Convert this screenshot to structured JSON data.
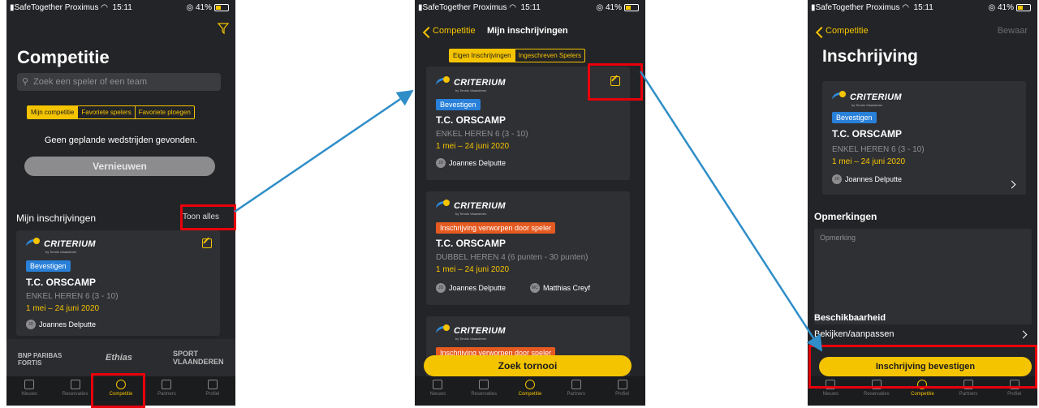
{
  "status": {
    "carrier": "SafeTogether Proximus",
    "time": "15:11",
    "battery": "41%"
  },
  "common": {
    "logo_text": "CRITERIUM",
    "logo_sub": "by Tennis Vlaanderen",
    "avatar_initials": "JD",
    "club": "T.C. ORSCAMP",
    "dates": "1 mei – 24 juni 2020",
    "player1": "Joannes Delputte",
    "badge_confirm": "Bevestigen",
    "badge_rejected": "Inschrijving verworpen door speler",
    "cat_single": "ENKEL HEREN 6 (3 - 10)"
  },
  "tabs": [
    "Nieuws",
    "Reservaties",
    "Competitie",
    "Partners",
    "Profiel"
  ],
  "screen1": {
    "title": "Competitie",
    "search_placeholder": "Zoek een speler of een team",
    "segments": [
      "Mijn competitie",
      "Favoriete spelers",
      "Favoriete ploegen"
    ],
    "empty_text": "Geen geplande wedstrijden gevonden.",
    "refresh_label": "Vernieuwen",
    "section_title": "Mijn inschrijvingen",
    "show_all": "Toon alles",
    "sponsors": [
      "BNP PARIBAS FORTIS",
      "Ethias",
      "SPORT VLAANDEREN"
    ]
  },
  "screen2": {
    "back_label": "Competitie",
    "title": "Mijn inschrijvingen",
    "segments": [
      "Eigen Inschrijvingen",
      "Ingeschreven Spelers"
    ],
    "card2_category": "DUBBEL HEREN 4 (6 punten - 30 punten)",
    "card2_player2": "Matthias Creyf",
    "avatar2_initials": "MC",
    "search_tournament": "Zoek tornooi"
  },
  "screen3": {
    "back_label": "Competitie",
    "save_label": "Bewaar",
    "title": "Inschrijving",
    "remarks_title": "Opmerkingen",
    "remarks_placeholder": "Opmerking",
    "availability_title": "Beschikbaarheid",
    "availability_link": "Bekijken/aanpassen",
    "confirm_button": "Inschrijving bevestigen"
  },
  "colors": {
    "accent": "#f5c400",
    "highlight": "#e8000b",
    "arrow": "#2f8ec8",
    "badge_blue": "#2980d9",
    "badge_orange": "#e55a20"
  }
}
